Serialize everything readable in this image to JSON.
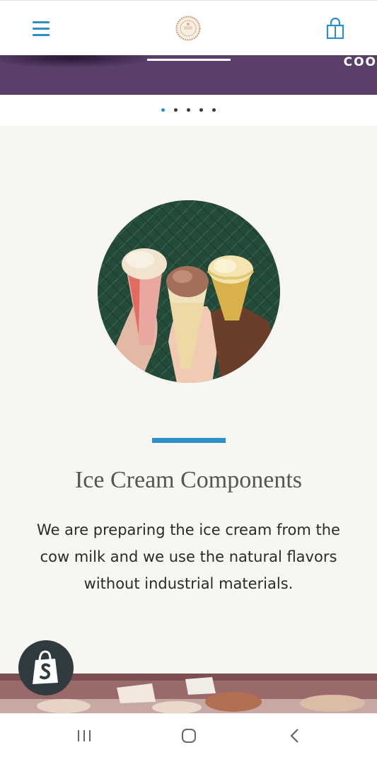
{
  "header": {
    "menu_icon": "hamburger-menu-icon",
    "logo_icon": "brand-seal-logo",
    "cart_icon": "shopping-bag-icon"
  },
  "slider": {
    "caption": "COO",
    "slide_count": 5,
    "active_slide": 1
  },
  "section": {
    "image_subject": "three ice cream cones",
    "title": "Ice Cream Components",
    "description": "We are preparing the ice cream from the cow milk and we use the natural flavors without industrial materials."
  },
  "badge": {
    "icon": "shopify-bag-icon"
  },
  "system_nav": {
    "recents_icon": "recents-icon",
    "home_icon": "home-icon",
    "back_icon": "back-icon"
  },
  "colors": {
    "accent": "#2b8fc8",
    "slider_bg": "#5a3f6b",
    "section_bg": "#f8f6f2",
    "badge_bg": "#2f3b3f"
  }
}
